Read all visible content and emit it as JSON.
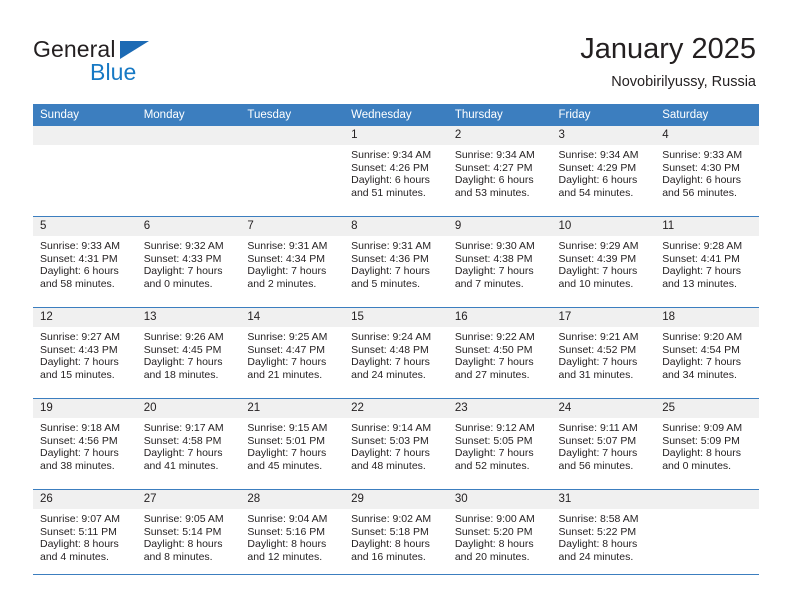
{
  "brand": {
    "name_part1": "General",
    "name_part2": "Blue",
    "triangle_color": "#1c6ab4",
    "blue_color": "#1779c4"
  },
  "header": {
    "title": "January 2025",
    "location": "Novobirilyussy, Russia"
  },
  "theme": {
    "header_blue": "#3c7ebf",
    "band_gray": "#f0f0f0",
    "text": "#231f20"
  },
  "calendar": {
    "weekday_headers": [
      "Sunday",
      "Monday",
      "Tuesday",
      "Wednesday",
      "Thursday",
      "Friday",
      "Saturday"
    ],
    "weeks": [
      [
        {
          "day": "",
          "lines": []
        },
        {
          "day": "",
          "lines": []
        },
        {
          "day": "",
          "lines": []
        },
        {
          "day": "1",
          "lines": [
            "Sunrise: 9:34 AM",
            "Sunset: 4:26 PM",
            "Daylight: 6 hours",
            "and 51 minutes."
          ]
        },
        {
          "day": "2",
          "lines": [
            "Sunrise: 9:34 AM",
            "Sunset: 4:27 PM",
            "Daylight: 6 hours",
            "and 53 minutes."
          ]
        },
        {
          "day": "3",
          "lines": [
            "Sunrise: 9:34 AM",
            "Sunset: 4:29 PM",
            "Daylight: 6 hours",
            "and 54 minutes."
          ]
        },
        {
          "day": "4",
          "lines": [
            "Sunrise: 9:33 AM",
            "Sunset: 4:30 PM",
            "Daylight: 6 hours",
            "and 56 minutes."
          ]
        }
      ],
      [
        {
          "day": "5",
          "lines": [
            "Sunrise: 9:33 AM",
            "Sunset: 4:31 PM",
            "Daylight: 6 hours",
            "and 58 minutes."
          ]
        },
        {
          "day": "6",
          "lines": [
            "Sunrise: 9:32 AM",
            "Sunset: 4:33 PM",
            "Daylight: 7 hours",
            "and 0 minutes."
          ]
        },
        {
          "day": "7",
          "lines": [
            "Sunrise: 9:31 AM",
            "Sunset: 4:34 PM",
            "Daylight: 7 hours",
            "and 2 minutes."
          ]
        },
        {
          "day": "8",
          "lines": [
            "Sunrise: 9:31 AM",
            "Sunset: 4:36 PM",
            "Daylight: 7 hours",
            "and 5 minutes."
          ]
        },
        {
          "day": "9",
          "lines": [
            "Sunrise: 9:30 AM",
            "Sunset: 4:38 PM",
            "Daylight: 7 hours",
            "and 7 minutes."
          ]
        },
        {
          "day": "10",
          "lines": [
            "Sunrise: 9:29 AM",
            "Sunset: 4:39 PM",
            "Daylight: 7 hours",
            "and 10 minutes."
          ]
        },
        {
          "day": "11",
          "lines": [
            "Sunrise: 9:28 AM",
            "Sunset: 4:41 PM",
            "Daylight: 7 hours",
            "and 13 minutes."
          ]
        }
      ],
      [
        {
          "day": "12",
          "lines": [
            "Sunrise: 9:27 AM",
            "Sunset: 4:43 PM",
            "Daylight: 7 hours",
            "and 15 minutes."
          ]
        },
        {
          "day": "13",
          "lines": [
            "Sunrise: 9:26 AM",
            "Sunset: 4:45 PM",
            "Daylight: 7 hours",
            "and 18 minutes."
          ]
        },
        {
          "day": "14",
          "lines": [
            "Sunrise: 9:25 AM",
            "Sunset: 4:47 PM",
            "Daylight: 7 hours",
            "and 21 minutes."
          ]
        },
        {
          "day": "15",
          "lines": [
            "Sunrise: 9:24 AM",
            "Sunset: 4:48 PM",
            "Daylight: 7 hours",
            "and 24 minutes."
          ]
        },
        {
          "day": "16",
          "lines": [
            "Sunrise: 9:22 AM",
            "Sunset: 4:50 PM",
            "Daylight: 7 hours",
            "and 27 minutes."
          ]
        },
        {
          "day": "17",
          "lines": [
            "Sunrise: 9:21 AM",
            "Sunset: 4:52 PM",
            "Daylight: 7 hours",
            "and 31 minutes."
          ]
        },
        {
          "day": "18",
          "lines": [
            "Sunrise: 9:20 AM",
            "Sunset: 4:54 PM",
            "Daylight: 7 hours",
            "and 34 minutes."
          ]
        }
      ],
      [
        {
          "day": "19",
          "lines": [
            "Sunrise: 9:18 AM",
            "Sunset: 4:56 PM",
            "Daylight: 7 hours",
            "and 38 minutes."
          ]
        },
        {
          "day": "20",
          "lines": [
            "Sunrise: 9:17 AM",
            "Sunset: 4:58 PM",
            "Daylight: 7 hours",
            "and 41 minutes."
          ]
        },
        {
          "day": "21",
          "lines": [
            "Sunrise: 9:15 AM",
            "Sunset: 5:01 PM",
            "Daylight: 7 hours",
            "and 45 minutes."
          ]
        },
        {
          "day": "22",
          "lines": [
            "Sunrise: 9:14 AM",
            "Sunset: 5:03 PM",
            "Daylight: 7 hours",
            "and 48 minutes."
          ]
        },
        {
          "day": "23",
          "lines": [
            "Sunrise: 9:12 AM",
            "Sunset: 5:05 PM",
            "Daylight: 7 hours",
            "and 52 minutes."
          ]
        },
        {
          "day": "24",
          "lines": [
            "Sunrise: 9:11 AM",
            "Sunset: 5:07 PM",
            "Daylight: 7 hours",
            "and 56 minutes."
          ]
        },
        {
          "day": "25",
          "lines": [
            "Sunrise: 9:09 AM",
            "Sunset: 5:09 PM",
            "Daylight: 8 hours",
            "and 0 minutes."
          ]
        }
      ],
      [
        {
          "day": "26",
          "lines": [
            "Sunrise: 9:07 AM",
            "Sunset: 5:11 PM",
            "Daylight: 8 hours",
            "and 4 minutes."
          ]
        },
        {
          "day": "27",
          "lines": [
            "Sunrise: 9:05 AM",
            "Sunset: 5:14 PM",
            "Daylight: 8 hours",
            "and 8 minutes."
          ]
        },
        {
          "day": "28",
          "lines": [
            "Sunrise: 9:04 AM",
            "Sunset: 5:16 PM",
            "Daylight: 8 hours",
            "and 12 minutes."
          ]
        },
        {
          "day": "29",
          "lines": [
            "Sunrise: 9:02 AM",
            "Sunset: 5:18 PM",
            "Daylight: 8 hours",
            "and 16 minutes."
          ]
        },
        {
          "day": "30",
          "lines": [
            "Sunrise: 9:00 AM",
            "Sunset: 5:20 PM",
            "Daylight: 8 hours",
            "and 20 minutes."
          ]
        },
        {
          "day": "31",
          "lines": [
            "Sunrise: 8:58 AM",
            "Sunset: 5:22 PM",
            "Daylight: 8 hours",
            "and 24 minutes."
          ]
        },
        {
          "day": "",
          "lines": []
        }
      ]
    ]
  }
}
